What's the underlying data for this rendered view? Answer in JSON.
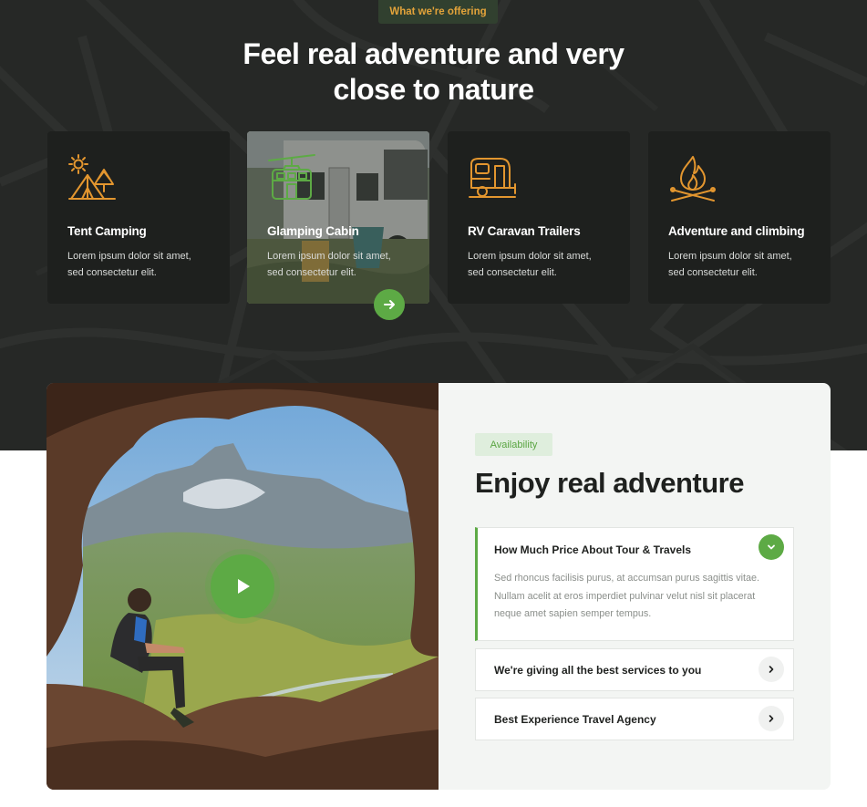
{
  "services": {
    "eyebrow": "What we're offering",
    "title_line1": "Feel real adventure and very",
    "title_line2": "close to nature",
    "cards": [
      {
        "title": "Tent Camping",
        "text_line1": "Lorem ipsum dolor sit amet,",
        "text_line2": "sed consectetur elit.",
        "icon": "tent-camping-icon"
      },
      {
        "title": "Glamping Cabin",
        "text_line1": "Lorem ipsum dolor sit amet,",
        "text_line2": "sed consectetur elit.",
        "icon": "cable-car-icon"
      },
      {
        "title": "RV Caravan Trailers",
        "text_line1": "Lorem ipsum dolor sit amet,",
        "text_line2": "sed consectetur elit.",
        "icon": "caravan-icon"
      },
      {
        "title": "Adventure and climbing",
        "text_line1": "Lorem ipsum dolor sit amet,",
        "text_line2": "sed consectetur elit.",
        "icon": "campfire-icon"
      }
    ]
  },
  "feature": {
    "badge": "Availability",
    "title": "Enjoy real adventure",
    "accordion": [
      {
        "question": "How Much Price About Tour & Travels",
        "answer_line1": "Sed rhoncus facilisis purus, at accumsan purus sagittis vitae.",
        "answer_line2": "Nullam acelit at eros imperdiet pulvinar velut nisl sit placerat",
        "answer_line3": "neque amet sapien semper tempus.",
        "open": true
      },
      {
        "question": "We're giving all the best services to you",
        "open": false
      },
      {
        "question": "Best Experience Travel Agency",
        "open": false
      }
    ]
  },
  "colors": {
    "accent": "#5daa45",
    "orange": "#e3962f",
    "dark_bg": "#262826"
  }
}
